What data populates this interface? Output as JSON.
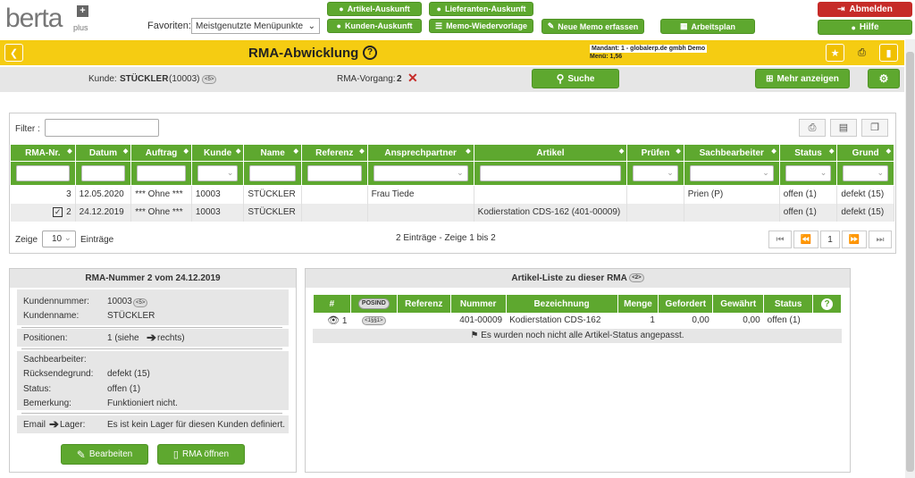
{
  "app": {
    "logo": "berta",
    "logo_sub": "plus"
  },
  "topnav": {
    "favoriten_label": "Favoriten:",
    "favoriten_value": "Meistgenutzte Menüpunkte",
    "artikel_auskunft": "Artikel-Auskunft",
    "lieferanten_auskunft": "Lieferanten-Auskunft",
    "kunden_auskunft": "Kunden-Auskunft",
    "memo_wiedervorlage": "Memo-Wiedervorlage",
    "neue_memo": "Neue Memo erfassen",
    "arbeitsplan": "Arbeitsplan",
    "abmelden": "Abmelden",
    "hilfe": "Hilfe"
  },
  "header": {
    "title": "RMA-Abwicklung",
    "mandant_line1": "Mandant: 1 - globalerp.de gmbh Demo",
    "mandant_line2": "Menü: 1,56"
  },
  "context": {
    "kunde_label": "Kunde:",
    "kunde_value": "STÜCKLER",
    "kunde_id": "(10003)",
    "kunde_badge": "<5>",
    "vorgang_label": "RMA-Vorgang:",
    "vorgang_value": "2",
    "suche": "Suche",
    "mehr_anzeigen": "Mehr anzeigen"
  },
  "list": {
    "filter_label": "Filter :",
    "columns": [
      "RMA-Nr.",
      "Datum",
      "Auftrag",
      "Kunde",
      "Name",
      "Referenz",
      "Ansprechpartner",
      "Artikel",
      "Prüfen",
      "Sachbearbeiter",
      "Status",
      "Grund"
    ],
    "rows": [
      {
        "rma": "3",
        "datum": "12.05.2020",
        "auftrag": "*** Ohne ***",
        "kunde": "10003",
        "name": "STÜCKLER",
        "referenz": "",
        "ansprechpartner": "Frau Tiede",
        "artikel": "",
        "pruefen": "",
        "sachbearbeiter": "Prien (P)",
        "status": "offen (1)",
        "grund": "defekt (15)"
      },
      {
        "rma": "2",
        "datum": "24.12.2019",
        "auftrag": "*** Ohne ***",
        "kunde": "10003",
        "name": "STÜCKLER",
        "referenz": "",
        "ansprechpartner": "",
        "artikel": "Kodierstation CDS-162 (401-00009)",
        "pruefen": "",
        "sachbearbeiter": "",
        "status": "offen (1)",
        "grund": "defekt (15)"
      }
    ],
    "zeige": "Zeige",
    "page_size": "10",
    "eintraege": "Einträge",
    "summary": "2 Einträge - Zeige 1 bis 2",
    "page_current": "1"
  },
  "detail": {
    "title": "RMA-Nummer 2 vom 24.12.2019",
    "kundennummer_label": "Kundennummer:",
    "kundennummer_value": "10003",
    "kundennummer_badge": "<5>",
    "kundenname_label": "Kundenname:",
    "kundenname_value": "STÜCKLER",
    "positionen_label": "Positionen:",
    "positionen_value": "1 (siehe",
    "positionen_suffix": "rechts)",
    "sachbearbeiter_label": "Sachbearbeiter:",
    "sachbearbeiter_value": "",
    "ruecksendegrund_label": "Rücksendegrund:",
    "ruecksendegrund_value": "defekt (15)",
    "status_label": "Status:",
    "status_value": "offen (1)",
    "bemerkung_label": "Bemerkung:",
    "bemerkung_value": "Funktioniert nicht.",
    "email_label": "Email",
    "lager_label": "Lager:",
    "email_value": "Es ist kein Lager für diesen Kunden definiert.",
    "bearbeiten": "Bearbeiten",
    "rma_oeffnen": "RMA öffnen"
  },
  "articles": {
    "title": "Artikel-Liste zu dieser RMA",
    "title_badge": "<2>",
    "columns": [
      "#",
      "POSIND",
      "Referenz",
      "Nummer",
      "Bezeichnung",
      "Menge",
      "Gefordert",
      "Gewährt",
      "Status",
      "?"
    ],
    "rows": [
      {
        "num": "1",
        "posind": "<1§§1>",
        "referenz": "",
        "nummer": "401-00009",
        "bezeichnung": "Kodierstation CDS-162",
        "menge": "1",
        "gefordert": "0,00",
        "gewaehrt": "0,00",
        "status": "offen (1)"
      }
    ],
    "notice": "Es wurden noch nicht alle Artikel-Status angepasst."
  },
  "colors": {
    "green": "#5ea82f",
    "yellow": "#f5cc12",
    "red": "#c62b28",
    "gray": "#e6e6e6"
  }
}
